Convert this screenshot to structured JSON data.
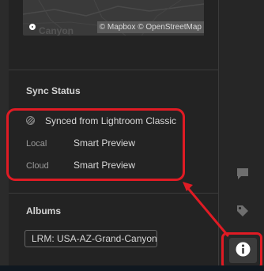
{
  "map": {
    "place_label": "Canyon",
    "attribution": "© Mapbox © OpenStreetMap"
  },
  "sync_status": {
    "title": "Sync Status",
    "status_text": "Synced from Lightroom Classic",
    "rows": [
      {
        "label": "Local",
        "value": "Smart Preview"
      },
      {
        "label": "Cloud",
        "value": "Smart Preview"
      }
    ]
  },
  "albums": {
    "title": "Albums",
    "items": [
      "LRM: USA-AZ-Grand-Canyon"
    ]
  },
  "rail": {
    "icons": [
      "comment-icon",
      "tag-icon",
      "info-icon"
    ],
    "active": "info-icon"
  },
  "colors": {
    "highlight": "#e01b24",
    "panel_bg": "#232323"
  }
}
